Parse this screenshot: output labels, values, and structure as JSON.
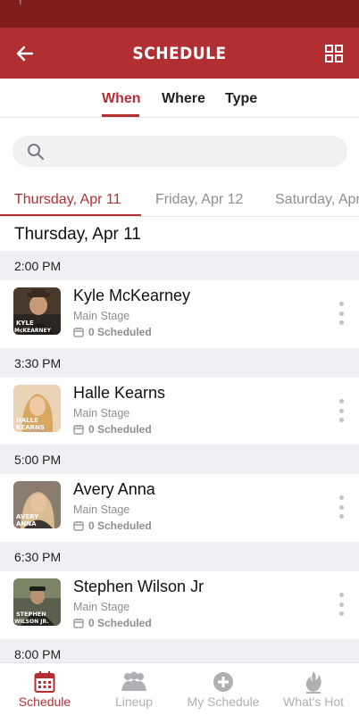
{
  "header": {
    "title": "SCHEDULE",
    "back_icon": "arrow-left-icon",
    "grid_icon": "grid-icon"
  },
  "seg_tabs": [
    {
      "label": "When"
    },
    {
      "label": "Where"
    },
    {
      "label": "Type"
    }
  ],
  "search": {
    "placeholder": "",
    "value": ""
  },
  "day_tabs": [
    {
      "label": "Thursday, Apr 11"
    },
    {
      "label": "Friday, Apr 12"
    },
    {
      "label": "Saturday, Apr"
    }
  ],
  "day_heading": "Thursday, Apr 11",
  "slots": [
    {
      "time": "2:00 PM",
      "artist": "Kyle McKearney",
      "stage": "Main Stage",
      "scheduled": "0 Scheduled",
      "thumb_text": "KYLE\nMcKEARNEY"
    },
    {
      "time": "3:30 PM",
      "artist": "Halle Kearns",
      "stage": "Main Stage",
      "scheduled": "0 Scheduled",
      "thumb_text": "HALLE\nKEARNS"
    },
    {
      "time": "5:00 PM",
      "artist": "Avery Anna",
      "stage": "Main Stage",
      "scheduled": "0 Scheduled",
      "thumb_text": "AVERY\nANNA"
    },
    {
      "time": "6:30 PM",
      "artist": "Stephen Wilson Jr",
      "stage": "Main Stage",
      "scheduled": "0 Scheduled",
      "thumb_text": "STEPHEN\nWILSON JR."
    }
  ],
  "next_time": "8:00 PM",
  "bottom_nav": [
    {
      "label": "Schedule",
      "icon": "calendar-icon",
      "active": true
    },
    {
      "label": "Lineup",
      "icon": "people-icon",
      "active": false
    },
    {
      "label": "My Schedule",
      "icon": "plus-circle-icon",
      "active": false
    },
    {
      "label": "What's Hot",
      "icon": "flame-icon",
      "active": false
    }
  ],
  "colors": {
    "accent": "#b12f33",
    "status_bar": "#7f1d1d",
    "muted": "#8e8e93",
    "section_bg": "#eef0f3"
  }
}
